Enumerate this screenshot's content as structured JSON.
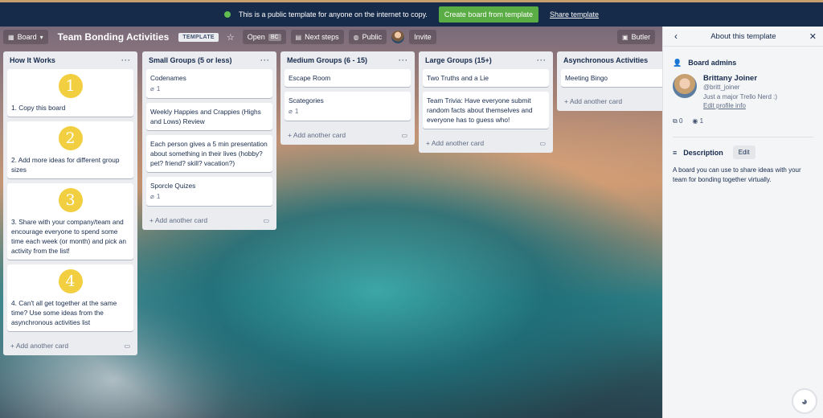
{
  "banner": {
    "message": "This is a public template for anyone on the internet to copy.",
    "create_button": "Create board from template",
    "share_link": "Share template"
  },
  "header": {
    "board_view": "Board",
    "title": "Team Bonding Activities",
    "template_badge": "TEMPLATE",
    "open_label": "Open",
    "open_badge": "BC",
    "next_steps": "Next steps",
    "visibility": "Public",
    "invite": "Invite",
    "butler": "Butler"
  },
  "lists": [
    {
      "title": "How It Works",
      "cards": [
        {
          "number": "1",
          "text": "1. Copy this board"
        },
        {
          "number": "2",
          "text": "2. Add more ideas for different group sizes"
        },
        {
          "number": "3",
          "text": "3. Share with your company/team and encourage everyone to spend some time each week (or month) and pick an activity from the list!"
        },
        {
          "number": "4",
          "text": "4. Can't all get together at the same time? Use some ideas from the asynchronous activities list"
        }
      ],
      "add_card": "Add another card"
    },
    {
      "title": "Small Groups (5 or less)",
      "cards": [
        {
          "text": "Codenames",
          "attachments": "1"
        },
        {
          "text": "Weekly Happies and Crappies (Highs and Lows) Review"
        },
        {
          "text": "Each person gives a 5 min presentation about something in their lives (hobby? pet? friend? skill? vacation?)"
        },
        {
          "text": "Sporcle Quizes",
          "attachments": "1"
        }
      ],
      "add_card": "Add another card"
    },
    {
      "title": "Medium Groups (6 - 15)",
      "cards": [
        {
          "text": "Escape Room"
        },
        {
          "text": "Scategories",
          "attachments": "1"
        }
      ],
      "add_card": "Add another card"
    },
    {
      "title": "Large Groups (15+)",
      "cards": [
        {
          "text": "Two Truths and a Lie"
        },
        {
          "text": "Team Trivia: Have everyone submit random facts about themselves and everyone has to guess who!"
        }
      ],
      "add_card": "Add another card"
    },
    {
      "title": "Asynchronous Activities",
      "cards": [
        {
          "text": "Meeting Bingo"
        }
      ],
      "add_card": "Add another card"
    }
  ],
  "sidebar": {
    "title": "About this template",
    "admins_label": "Board admins",
    "admin_name": "Brittany Joiner",
    "admin_handle": "@britt_joiner",
    "admin_bio": "Just a major Trello Nerd :)",
    "edit_profile": "Edit profile info",
    "copies": "0",
    "views": "1",
    "description_label": "Description",
    "edit_button": "Edit",
    "description": "A board you can use to share ideas with your team for bonding together virtually."
  }
}
